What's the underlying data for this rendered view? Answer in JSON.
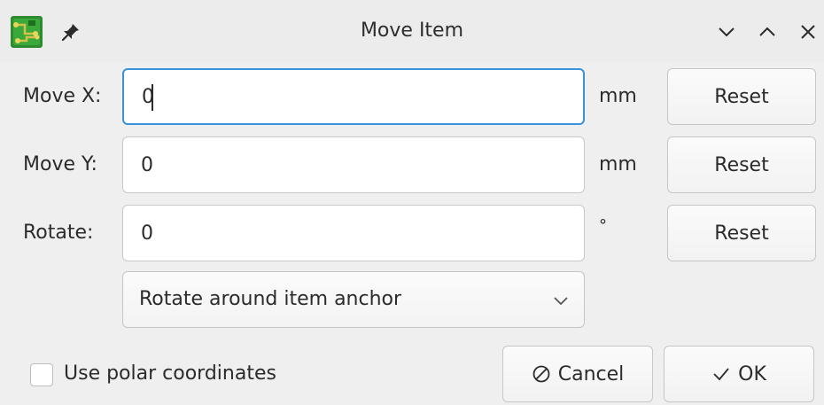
{
  "window": {
    "title": "Move Item"
  },
  "titlebar": {
    "app_icon": "pcbnew-icon",
    "pin_icon": "pin-icon",
    "minimize_icon": "chevron-down-icon",
    "maximize_icon": "chevron-up-icon",
    "close_icon": "close-icon"
  },
  "form": {
    "move_x": {
      "label": "Move X:",
      "value": "0",
      "unit": "mm",
      "reset_label": "Reset"
    },
    "move_y": {
      "label": "Move Y:",
      "value": "0",
      "unit": "mm",
      "reset_label": "Reset"
    },
    "rotate": {
      "label": "Rotate:",
      "value": "0",
      "unit": "°",
      "reset_label": "Reset"
    },
    "rotation_anchor": {
      "selected": "Rotate around item anchor"
    }
  },
  "footer": {
    "polar_checkbox_label": "Use polar coordinates",
    "polar_checked": false,
    "cancel_label": "Cancel",
    "ok_label": "OK"
  },
  "colors": {
    "focus": "#3a93d9",
    "background": "#efefef",
    "text": "#2b2b2b"
  }
}
